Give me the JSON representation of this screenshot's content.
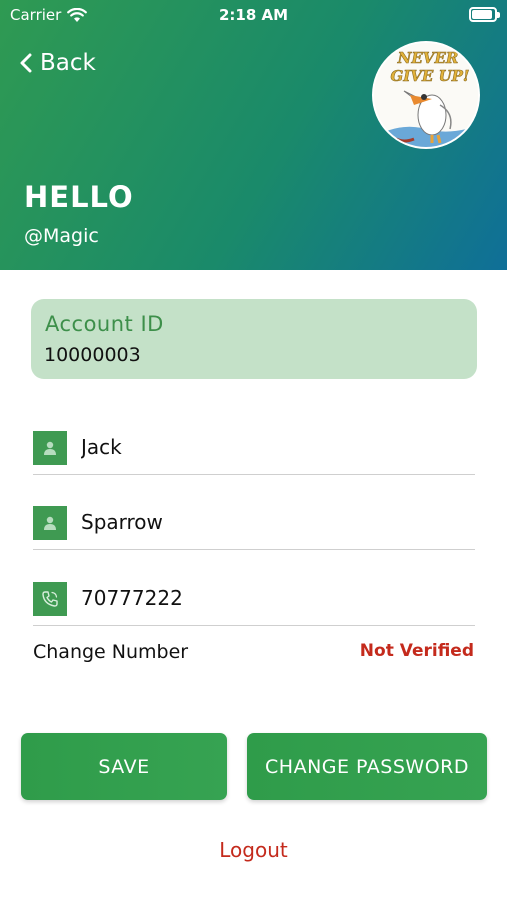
{
  "status_bar": {
    "carrier": "Carrier",
    "wifi_icon": "wifi-icon",
    "time": "2:18 AM",
    "battery_icon": "battery-icon"
  },
  "header": {
    "back_label": "Back",
    "back_icon": "chevron-left-icon",
    "greeting": "HELLO",
    "username": "@Magic",
    "avatar_text_line1": "NEVER",
    "avatar_text_line2": "GIVE UP!",
    "gradient_start": "#2f9a52",
    "gradient_end": "#0f6f98"
  },
  "account": {
    "label": "Account ID",
    "value": "10000003",
    "card_color": "#c4e1c8"
  },
  "fields": [
    {
      "icon": "person-icon",
      "value": "Jack"
    },
    {
      "icon": "person-icon",
      "value": "Sparrow"
    },
    {
      "icon": "phone-icon",
      "value": "70777222"
    }
  ],
  "phone": {
    "change_label": "Change Number",
    "status": "Not Verified"
  },
  "actions": {
    "save_label": "SAVE",
    "change_password_label": "CHANGE PASSWORD",
    "logout_label": "Logout"
  },
  "colors": {
    "accent": "#3f9a52",
    "danger": "#c42a1c"
  }
}
